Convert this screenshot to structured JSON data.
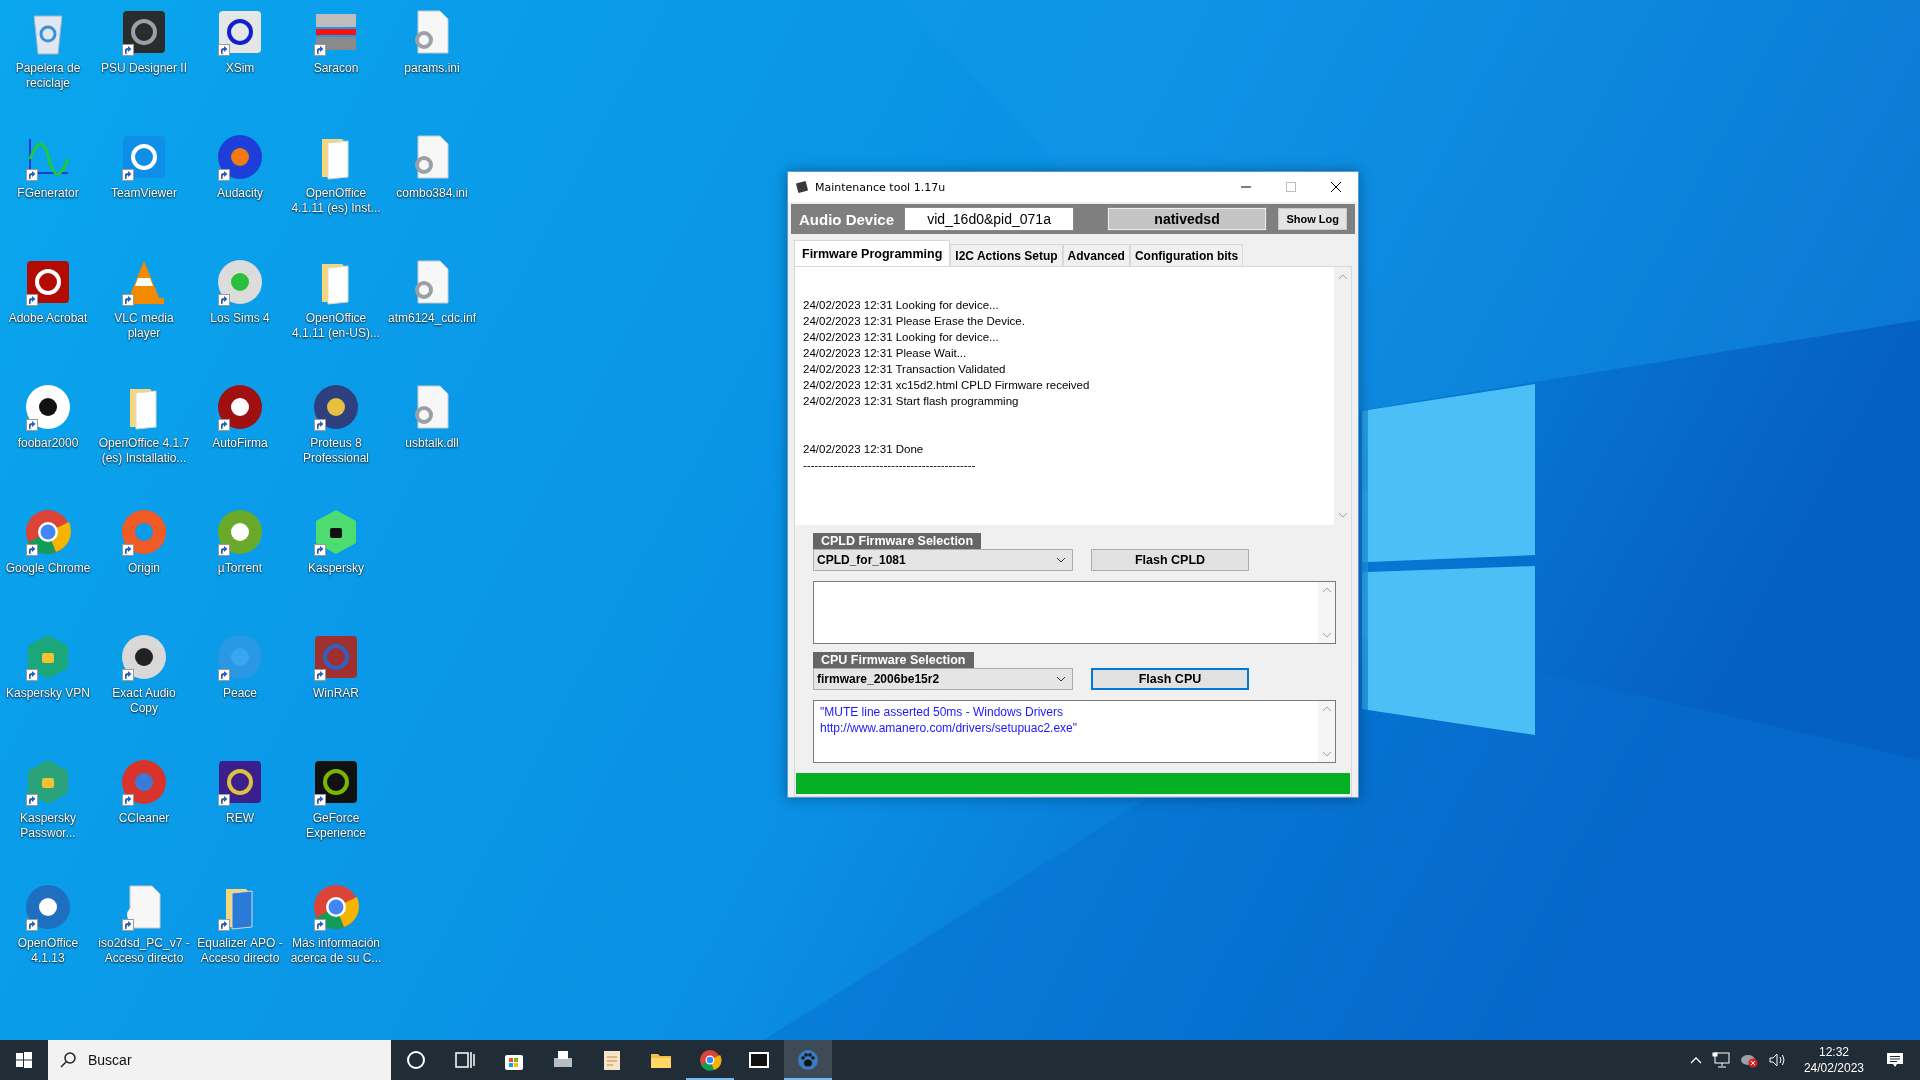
{
  "desktop": {
    "icons": [
      {
        "label": "Papelera de reciclaje",
        "shortcut": false
      },
      {
        "label": "FGenerator",
        "shortcut": true
      },
      {
        "label": "Adobe Acrobat",
        "shortcut": true
      },
      {
        "label": "foobar2000",
        "shortcut": true
      },
      {
        "label": "Google Chrome",
        "shortcut": true
      },
      {
        "label": "Kaspersky VPN",
        "shortcut": true
      },
      {
        "label": "Kaspersky Passwor...",
        "shortcut": true
      },
      {
        "label": "OpenOffice 4.1.13",
        "shortcut": true
      },
      {
        "label": "PSU Designer II",
        "shortcut": true
      },
      {
        "label": "TeamViewer",
        "shortcut": true
      },
      {
        "label": "VLC media player",
        "shortcut": true
      },
      {
        "label": "OpenOffice 4.1.7 (es) Installatio...",
        "shortcut": false
      },
      {
        "label": "Origin",
        "shortcut": true
      },
      {
        "label": "Exact Audio Copy",
        "shortcut": true
      },
      {
        "label": "CCleaner",
        "shortcut": true
      },
      {
        "label": "iso2dsd_PC_v7 - Acceso directo",
        "shortcut": true
      },
      {
        "label": "XSim",
        "shortcut": true
      },
      {
        "label": "Audacity",
        "shortcut": true
      },
      {
        "label": "Los Sims 4",
        "shortcut": true
      },
      {
        "label": "AutoFirma",
        "shortcut": true
      },
      {
        "label": "µTorrent",
        "shortcut": true
      },
      {
        "label": "Peace",
        "shortcut": true
      },
      {
        "label": "REW",
        "shortcut": true
      },
      {
        "label": "Equalizer APO - Acceso directo",
        "shortcut": true
      },
      {
        "label": "Saracon",
        "shortcut": true
      },
      {
        "label": "OpenOffice 4.1.11 (es) Inst...",
        "shortcut": false
      },
      {
        "label": "OpenOffice 4.1.11 (en-US)...",
        "shortcut": false
      },
      {
        "label": "Proteus 8 Professional",
        "shortcut": true
      },
      {
        "label": "Kaspersky",
        "shortcut": true
      },
      {
        "label": "WinRAR",
        "shortcut": true
      },
      {
        "label": "GeForce Experience",
        "shortcut": true
      },
      {
        "label": "Más información acerca de su C...",
        "shortcut": true
      },
      {
        "label": "params.ini",
        "shortcut": false
      },
      {
        "label": "combo384.ini",
        "shortcut": false
      },
      {
        "label": "atm6124_cdc.inf",
        "shortcut": false
      },
      {
        "label": "usbtalk.dll",
        "shortcut": false
      }
    ]
  },
  "window": {
    "title": "Maintenance tool 1.17u",
    "header": {
      "label": "Audio Device",
      "device_id": "vid_16d0&pid_071a",
      "mode": "nativedsd",
      "show_log_button": "Show Log"
    },
    "tabs": [
      {
        "label": "Firmware Programming",
        "selected": true
      },
      {
        "label": "I2C Actions Setup",
        "selected": false
      },
      {
        "label": "Advanced",
        "selected": false
      },
      {
        "label": "Configuration bits",
        "selected": false
      }
    ],
    "log_blocks": [
      {
        "lines": [
          "24/02/2023 12:31 Looking for device...",
          "24/02/2023 12:31 Please Erase the Device.",
          "24/02/2023 12:31 Looking for device...",
          "24/02/2023 12:31 Please Wait...",
          "24/02/2023 12:31 Transaction Validated",
          "24/02/2023 12:31 xc15d2.html CPLD Firmware received",
          "24/02/2023 12:31 Start flash programming"
        ]
      },
      {
        "lines": [
          "24/02/2023 12:31 Done",
          "---------------------------------------------"
        ]
      }
    ],
    "cpld": {
      "label": "CPLD Firmware Selection",
      "selection": "CPLD_for_1081",
      "button": {
        "label": "Flash CPLD",
        "focused": false
      }
    },
    "cpu": {
      "label": "CPU Firmware Selection",
      "selection": "firmware_2006be15r2",
      "button": {
        "label": "Flash CPU",
        "focused": true
      },
      "notes": "\"MUTE line asserted 50ms - Windows Drivers\nhttp://www.amanero.com/drivers/setupuac2.exe\""
    },
    "progress": {
      "level": 1
    }
  },
  "taskbar": {
    "search_placeholder": "Buscar",
    "apps": [
      {
        "running": false,
        "selected": false
      },
      {
        "running": false,
        "selected": false
      },
      {
        "running": false,
        "selected": false
      },
      {
        "running": false,
        "selected": false
      },
      {
        "running": false,
        "selected": false
      },
      {
        "running": false,
        "selected": false
      },
      {
        "running": true,
        "selected": false
      },
      {
        "running": false,
        "selected": false
      },
      {
        "running": true,
        "selected": true
      }
    ],
    "clock": {
      "time": "12:32",
      "date": "24/02/2023"
    }
  }
}
